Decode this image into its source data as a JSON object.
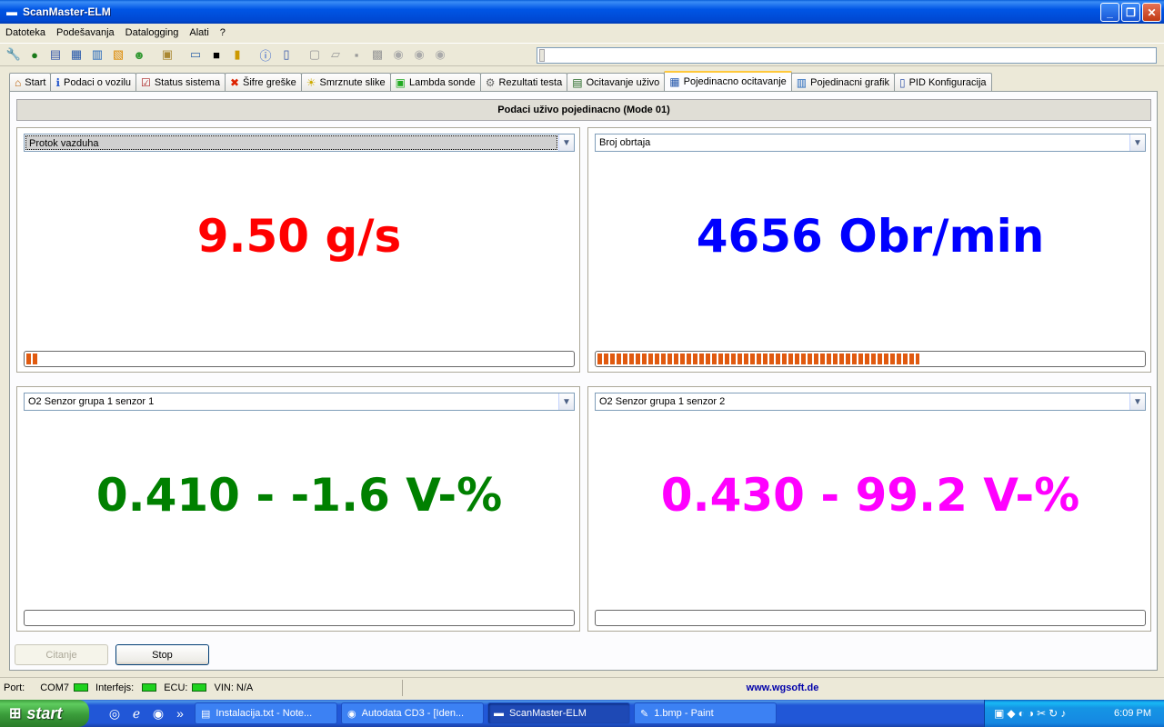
{
  "window": {
    "title": "ScanMaster-ELM",
    "minimize": "_",
    "maximize": "❐",
    "close": "✕"
  },
  "menu": [
    "Datoteka",
    "Podešavanja",
    "Datalogging",
    "Alati",
    "?"
  ],
  "toolbar_icons": [
    "wrench-icon",
    "globe-icon",
    "document-icon",
    "grid-icon",
    "chart-icon",
    "color-chart-icon",
    "people-icon",
    "clipboard-icon",
    "monitor-icon",
    "terminal-icon",
    "battery-icon",
    "info-icon",
    "book-icon",
    "new-file-icon",
    "open-file-icon",
    "save-icon",
    "print-icon",
    "play-icon",
    "pause-icon",
    "stop-icon"
  ],
  "tabs": [
    {
      "label": "Start",
      "icon": "⌂",
      "active": false
    },
    {
      "label": "Podaci o vozilu",
      "icon": "ℹ",
      "active": false
    },
    {
      "label": "Status sistema",
      "icon": "☑",
      "active": false
    },
    {
      "label": "Šifre greške",
      "icon": "✖",
      "active": false
    },
    {
      "label": "Smrznute slike",
      "icon": "☀",
      "active": false
    },
    {
      "label": "Lambda sonde",
      "icon": "▣",
      "active": false
    },
    {
      "label": "Rezultati testa",
      "icon": "⚙",
      "active": false
    },
    {
      "label": "Ocitavanje uživo",
      "icon": "▤",
      "active": false
    },
    {
      "label": "Pojedinacno ocitavanje",
      "icon": "▦",
      "active": true
    },
    {
      "label": "Pojedinacni grafik",
      "icon": "▥",
      "active": false
    },
    {
      "label": "PID Konfiguracija",
      "icon": "▯",
      "active": false
    }
  ],
  "section_title": "Podaci uživo pojedinacno (Mode 01)",
  "gauges": [
    {
      "selected": "Protok vazduha",
      "value": "9.50 g/s",
      "color": "#ff0000",
      "fill": 0.02
    },
    {
      "selected": "Broj obrtaja",
      "value": "4656 Obr/min",
      "color": "#0000ff",
      "fill": 0.59
    },
    {
      "selected": "O2 Senzor grupa 1 senzor 1",
      "value": "0.410 - -1.6 V-%",
      "color": "#008000",
      "fill": 0
    },
    {
      "selected": "O2 Senzor grupa 1 senzor 2",
      "value": "0.430 - 99.2 V-%",
      "color": "#ff00ff",
      "fill": 0
    }
  ],
  "buttons": {
    "read": "Citanje",
    "stop": "Stop"
  },
  "status": {
    "port_label": "Port:",
    "port_value": "COM7",
    "interface_label": "Interfejs:",
    "ecu_label": "ECU:",
    "vin": "VIN: N/A",
    "link": "www.wgsoft.de"
  },
  "taskbar": {
    "start": "start",
    "tasks": [
      {
        "label": "Instalacija.txt - Note...",
        "icon": "▤",
        "active": false
      },
      {
        "label": "Autodata CD3 - [Iden...",
        "icon": "◉",
        "active": false
      },
      {
        "label": "ScanMaster-ELM",
        "icon": "▬",
        "active": true
      },
      {
        "label": "1.bmp - Paint",
        "icon": "✎",
        "active": false
      }
    ],
    "clock": "6:09 PM"
  }
}
